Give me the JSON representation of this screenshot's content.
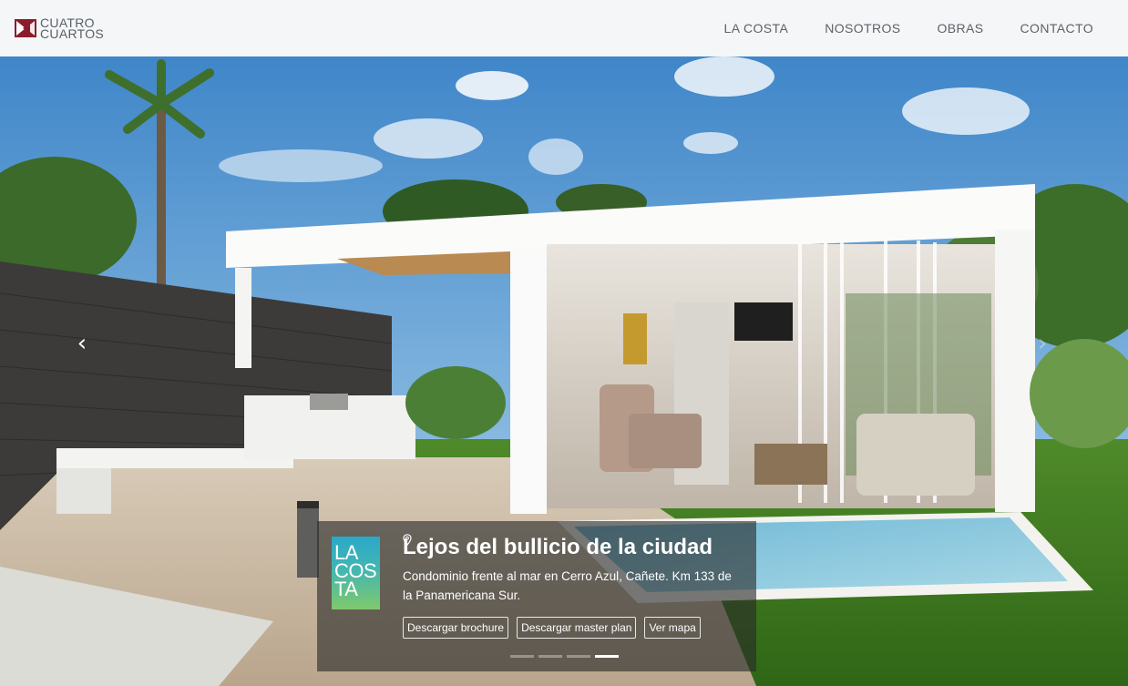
{
  "brand": {
    "line1": "CUATRO",
    "line2": "CUARTOS",
    "logo_icon": "cuatro-cuartos-logo-icon",
    "logo_color": "#8b1c2e"
  },
  "nav": {
    "items": [
      {
        "label": "LA COSTA"
      },
      {
        "label": "NOSOTROS"
      },
      {
        "label": "OBRAS"
      },
      {
        "label": "CONTACTO"
      }
    ]
  },
  "slider": {
    "prev_icon": "chevron-left-icon",
    "next_icon": "chevron-right-icon",
    "active_slide": 4,
    "slide_count": 4,
    "caption": {
      "logo_lines": [
        "LA",
        "COS",
        "TA"
      ],
      "title": "Lejos del bullicio de la ciudad",
      "description": "Condominio frente al mar en Cerro Azul, Cañete. Km 133 de la Panamericana Sur.",
      "buttons": {
        "brochure": "Descargar brochure",
        "master_plan": "Descargar master plan",
        "map": "Ver mapa",
        "map_icon": "map-pin-icon"
      }
    }
  },
  "colors": {
    "header_bg": "#f4f6f8",
    "nav_text": "#5d6268",
    "caption_bg": "rgba(40,42,40,0.62)"
  }
}
